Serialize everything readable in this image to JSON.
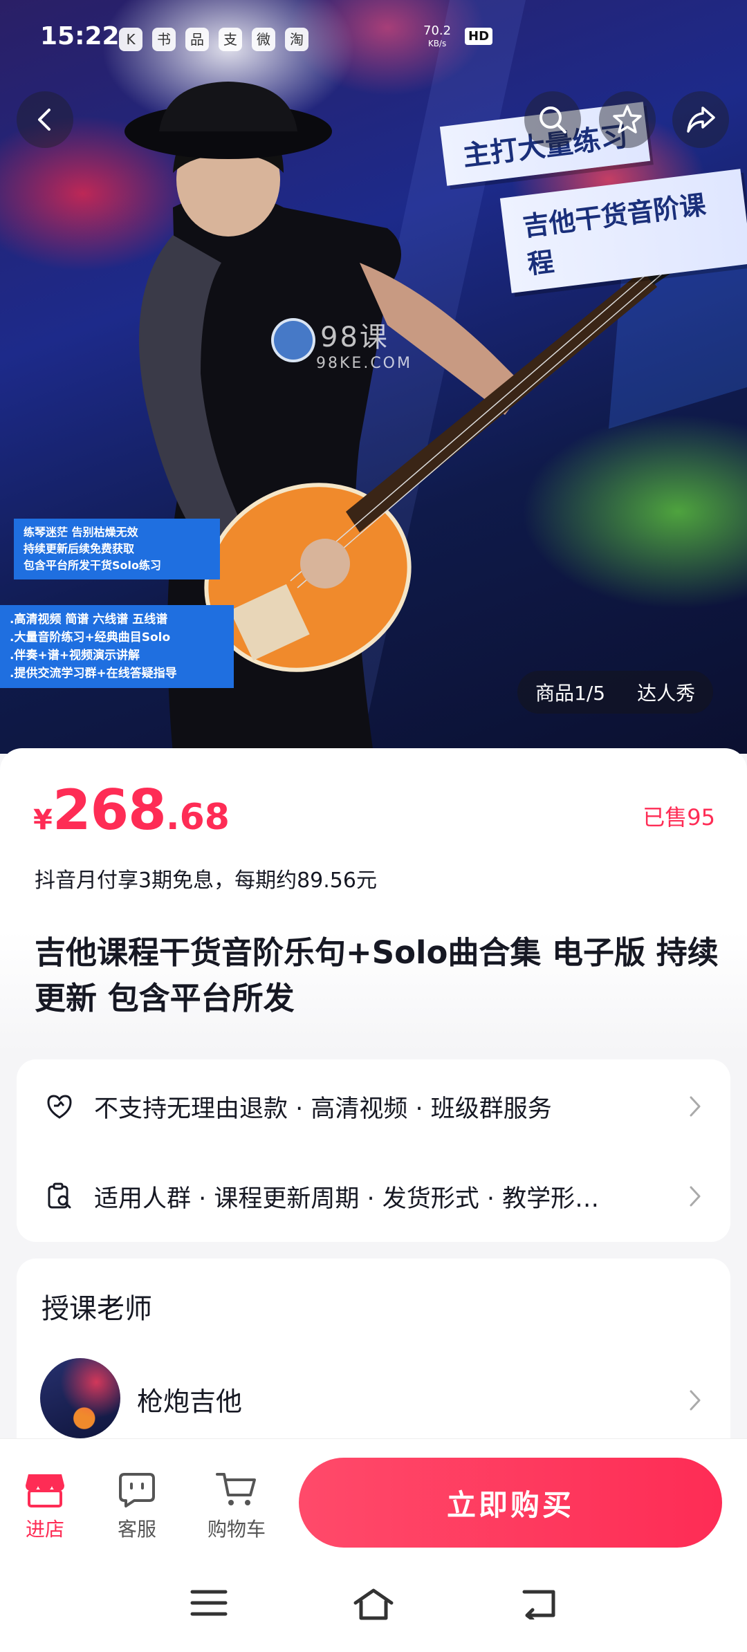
{
  "status_bar": {
    "time": "15:22",
    "app_icons": [
      "K",
      "书",
      "品",
      "支",
      "微",
      "淘"
    ],
    "net_speed_value": "70.2",
    "net_speed_unit": "KB/s",
    "network_badge": "HD"
  },
  "hero": {
    "banner_line_1": "主打大量练习",
    "banner_line_2": "吉他干货音阶课程",
    "promo_box_1": [
      "练琴迷茫 告别枯燥无效",
      "持续更新后续免费获取",
      "包含平台所发干货Solo练习"
    ],
    "promo_box_2": [
      ".高清视频 简谱 六线谱 五线谱",
      ".大量音阶练习+经典曲目Solo",
      ".伴奏+谱+视频演示讲解",
      ".提供交流学习群+在线答疑指导"
    ],
    "watermark_text": "98课",
    "watermark_url": "98KE.COM",
    "image_counter": "商品1/5",
    "influencer_tab": "达人秀"
  },
  "price": {
    "symbol": "¥",
    "integer": "268",
    "decimal": ".68",
    "sold": "已售95"
  },
  "installment": "抖音月付享3期免息，每期约89.56元",
  "title": "吉他课程干货音阶乐句+Solo曲合集 电子版 持续更新 包含平台所发",
  "services": {
    "row1": "不支持无理由退款 · 高清视频 · 班级群服务",
    "row2": "适用人群 · 课程更新周期 · 发货形式 · 教学形…"
  },
  "teacher": {
    "heading": "授课老师",
    "name": "枪炮吉他"
  },
  "bottom_nav": {
    "store": "进店",
    "customer_service": "客服",
    "cart": "购物车",
    "buy": "立即购买"
  },
  "colors": {
    "accent": "#fe2c55",
    "promo_blue": "#1f6fe0"
  }
}
